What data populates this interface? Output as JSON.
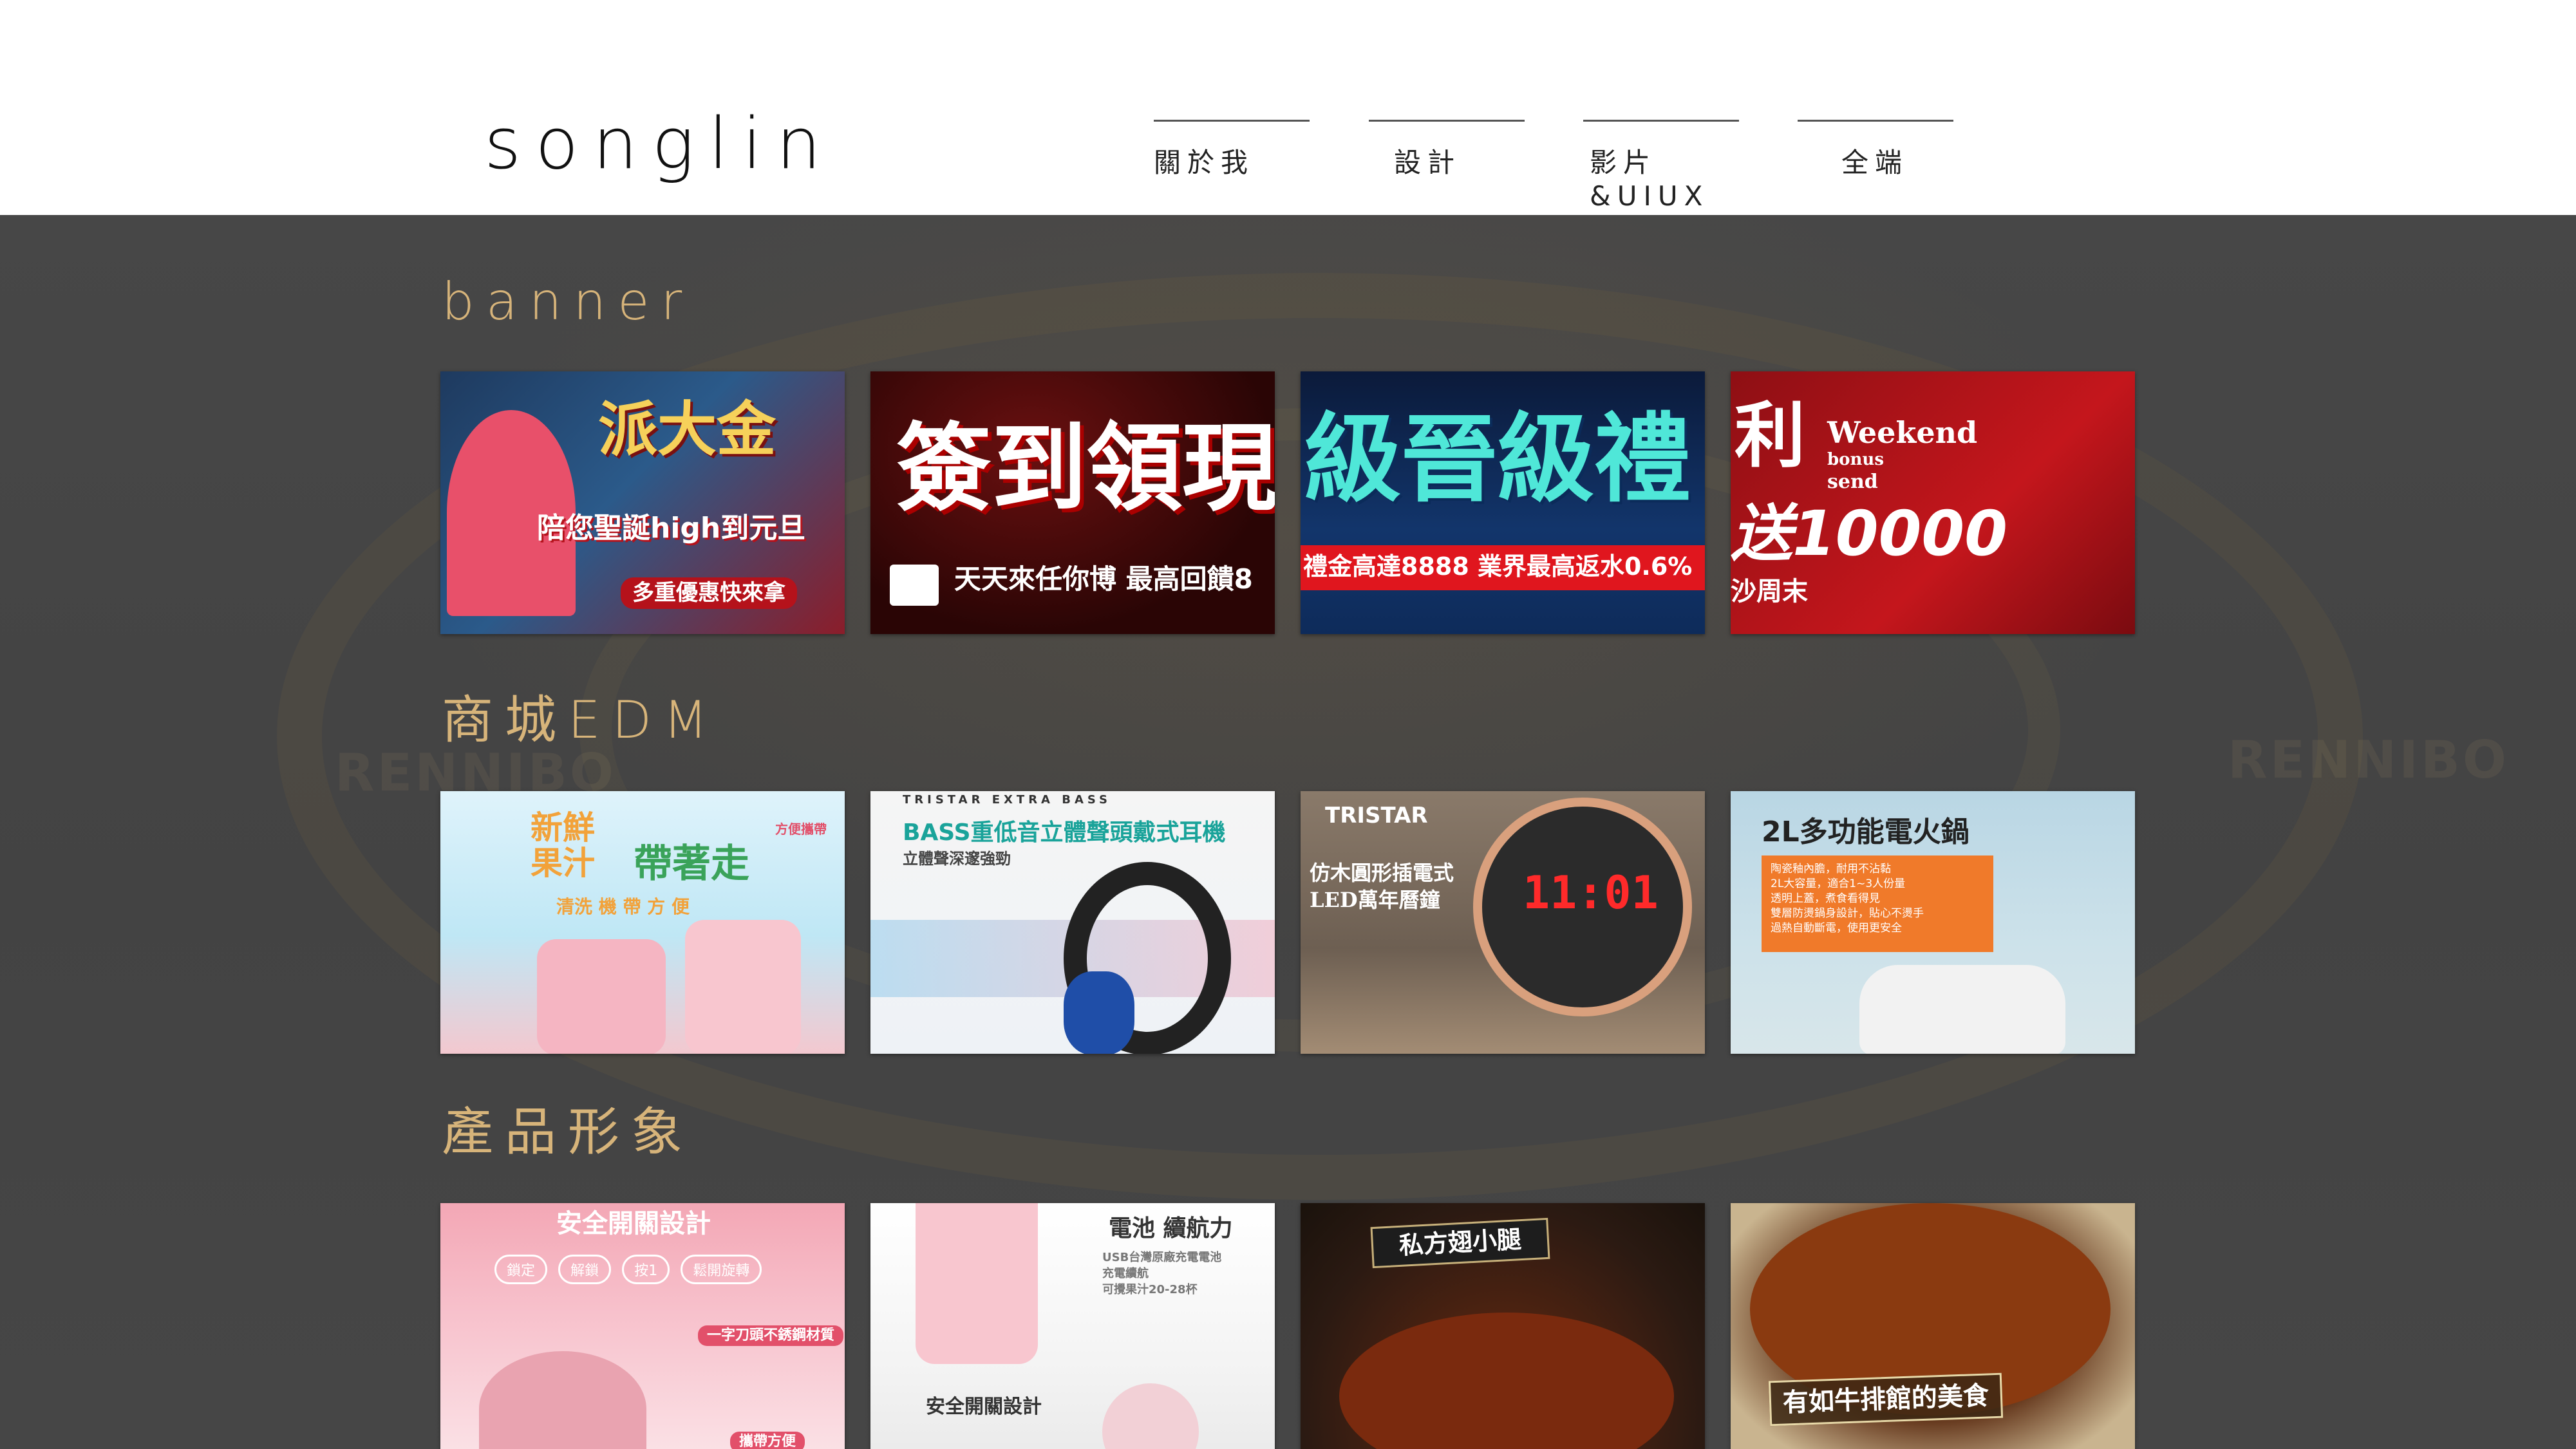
{
  "header": {
    "logo": "songlin",
    "nav": [
      {
        "label": "關於我"
      },
      {
        "label": "設計"
      },
      {
        "label": "影片&UIUX"
      },
      {
        "label": "全端"
      }
    ]
  },
  "background": {
    "watermarks": [
      "RENNIBO",
      "RENNIBO"
    ]
  },
  "sections": [
    {
      "title": "banner",
      "items": [
        {
          "line1": "派大金",
          "line2": "陪您聖誕high到元旦",
          "line3": "多重優惠快來拿"
        },
        {
          "line1": "簽到領現",
          "line2": "天天來任你博 最高回饋8"
        },
        {
          "line1": "級晉級禮",
          "line2": "禮金高達8888 業界最高返水0.6%"
        },
        {
          "line1": "利",
          "line2": "Weekend",
          "line3": "bonus",
          "line4": "send",
          "line5": "送10000",
          "line6": "沙周末"
        }
      ]
    },
    {
      "title": "商城EDM",
      "items": [
        {
          "line1": "新鮮果汁",
          "line2": "帶著走",
          "line3": "清洗 機 帶 方 便",
          "line4": "方便攜帶"
        },
        {
          "line1": "TRISTAR EXTRA BASS",
          "line2": "BASS重低音立體聲頭戴式耳機",
          "line3": "立體聲深邃強勁"
        },
        {
          "line1": "TRISTAR",
          "line2": "仿木圓形插電式",
          "line3": "LED萬年曆鐘",
          "line4": "11:01"
        },
        {
          "line1": "2L多功能電火鍋",
          "line2": "陶瓷釉內膽，耐用不沾黏",
          "line3": "2L大容量，適合1~3人份量",
          "line4": "透明上蓋，煮食看得見",
          "line5": "雙層防燙鍋身設計，貼心不燙手",
          "line6": "過熱自動斷電，使用更安全"
        }
      ]
    },
    {
      "title": "產品形象",
      "items": [
        {
          "line1": "安全開關設計",
          "pills": [
            "鎖定",
            "解鎖",
            "按1",
            "鬆開旋轉"
          ],
          "line2": "一字刀頭不銹鋼材質",
          "line3": "攜帶方便"
        },
        {
          "line1": "電池 續航力",
          "line2": "USB台灣原廠充電電池",
          "line3": "充電續航",
          "line4": "可攪果汁20-28杯",
          "line5": "安全開關設計"
        },
        {
          "line1": "私方翅小腿"
        },
        {
          "line1": "有如牛排館的美食"
        }
      ]
    }
  ]
}
